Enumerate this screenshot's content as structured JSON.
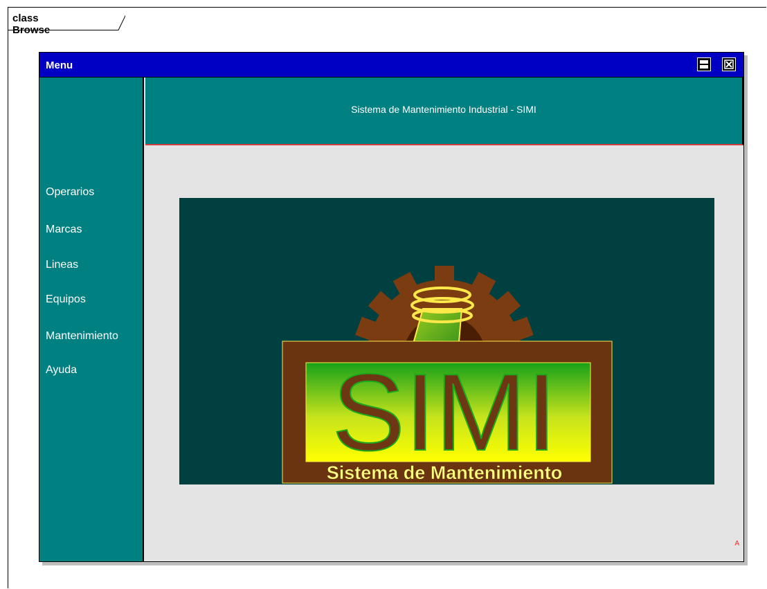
{
  "diagram": {
    "frame_label": "class Browse"
  },
  "window": {
    "title": "Menu",
    "controls": [
      {
        "name": "maximize",
        "icon": "maximize-icon"
      },
      {
        "name": "close",
        "icon": "close-icon"
      }
    ]
  },
  "sidebar": {
    "items": [
      {
        "label": "Operarios"
      },
      {
        "label": "Marcas"
      },
      {
        "label": "Lineas"
      },
      {
        "label": "Equipos"
      },
      {
        "label": "Mantenimiento"
      },
      {
        "label": "Ayuda"
      }
    ]
  },
  "header": {
    "title": "Sistema de Mantenimiento Industrial - SIMI"
  },
  "logo": {
    "text": "SIMI",
    "subtitle": "Sistema de Mantenimiento"
  },
  "anchor_mark": "A",
  "colors": {
    "titlebar": "#0000c4",
    "sidebar": "#008080",
    "content_bg": "#e4e4e4",
    "banner_bg": "#004040",
    "gear": "#7a3c10",
    "logo_text": "#6e3714"
  }
}
